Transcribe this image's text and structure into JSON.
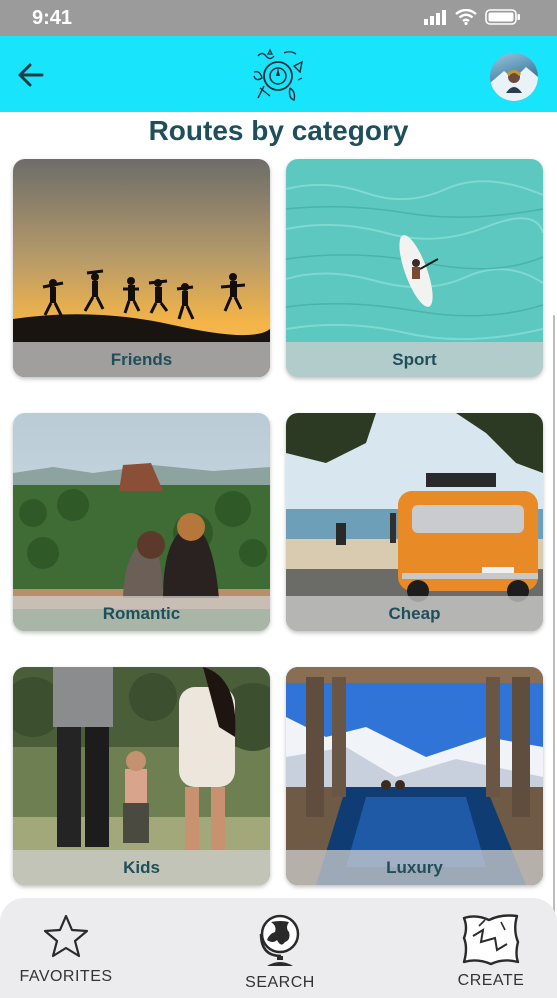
{
  "status_bar": {
    "time": "9:41"
  },
  "header": {
    "back_icon": "arrow-left-icon",
    "logo_icon": "travel-doodle-logo-icon",
    "avatar_icon": "user-avatar"
  },
  "page": {
    "title": "Routes by category"
  },
  "categories": [
    {
      "label": "Friends",
      "image": "friends-silhouettes-sunset"
    },
    {
      "label": "Sport",
      "image": "paddleboard-turquoise-sea"
    },
    {
      "label": "Romantic",
      "image": "couple-overlooking-rock"
    },
    {
      "label": "Cheap",
      "image": "orange-van-beach"
    },
    {
      "label": "Kids",
      "image": "family-walking-child"
    },
    {
      "label": "Luxury",
      "image": "pool-snowy-mountains"
    }
  ],
  "bottom_nav": {
    "items": [
      {
        "label": "FAVORITES",
        "icon": "star-icon"
      },
      {
        "label": "SEARCH",
        "icon": "globe-icon"
      },
      {
        "label": "CREATE",
        "icon": "map-icon"
      }
    ]
  },
  "colors": {
    "header_bg": "#18e4fb",
    "title_color": "#1f4f5a",
    "status_bar_bg": "#9b9b9b",
    "nav_bg": "#ececee"
  }
}
